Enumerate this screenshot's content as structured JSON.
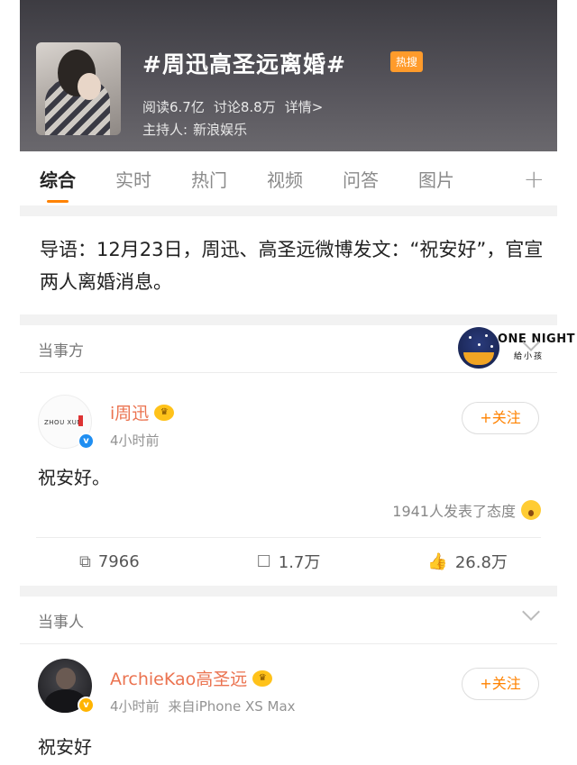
{
  "topic": {
    "title": "#周迅高圣远离婚#",
    "badge": "热搜",
    "reads": "阅读6.7亿",
    "discussions": "讨论8.8万",
    "details": "详情>",
    "host_label": "主持人:",
    "host_name": "新浪娱乐"
  },
  "tabs": [
    "综合",
    "实时",
    "热门",
    "视频",
    "问答",
    "图片"
  ],
  "tab_plus": "+",
  "intro": "导语：12月23日，周迅、高圣远微博发文：“祝安好”，官宣两人离婚消息。",
  "section1": {
    "label": "当事方",
    "ad_line1": "ONE NIGHT",
    "ad_line2": "給小孩"
  },
  "post1": {
    "avatar_text": "ZHOU XUN",
    "username": "i周迅",
    "time": "4小时前",
    "follow": "+关注",
    "content": "祝安好。",
    "reactions": "1941人发表了态度",
    "reposts": "7966",
    "comments": "1.7万",
    "likes": "26.8万"
  },
  "section2": {
    "label": "当事人"
  },
  "post2": {
    "username": "ArchieKao高圣远",
    "time": "4小时前",
    "source": "来自iPhone XS Max",
    "follow": "+关注",
    "content": "祝安好"
  },
  "colors": {
    "accent": "#ff8200",
    "username": "#eb7350",
    "hot_badge": "#ff9b2b",
    "verified_blue": "#1f8ef1",
    "verified_gold": "#ffb400"
  }
}
